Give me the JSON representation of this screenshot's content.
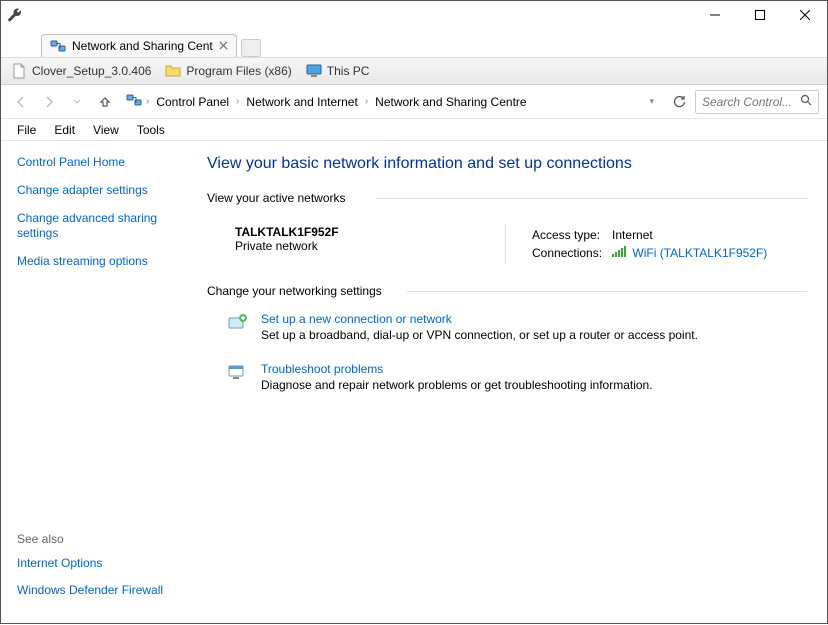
{
  "window": {
    "tab_title": "Network and Sharing Cent"
  },
  "bookmarks": [
    {
      "label": "Clover_Setup_3.0.406",
      "icon": "file-icon"
    },
    {
      "label": "Program Files (x86)",
      "icon": "folder-icon"
    },
    {
      "label": "This PC",
      "icon": "monitor-icon"
    }
  ],
  "breadcrumb": {
    "items": [
      "Control Panel",
      "Network and Internet",
      "Network and Sharing Centre"
    ]
  },
  "search": {
    "placeholder": "Search Control..."
  },
  "menubar": [
    "File",
    "Edit",
    "View",
    "Tools"
  ],
  "sidebar": {
    "home": "Control Panel Home",
    "links": [
      "Change adapter settings",
      "Change advanced sharing settings",
      "Media streaming options"
    ],
    "seealso_label": "See also",
    "seealso": [
      "Internet Options",
      "Windows Defender Firewall"
    ]
  },
  "main": {
    "heading": "View your basic network information and set up connections",
    "active_label": "View your active networks",
    "network": {
      "name": "TALKTALK1F952F",
      "type": "Private network",
      "access_label": "Access type:",
      "access_value": "Internet",
      "conn_label": "Connections:",
      "conn_value": "WiFi (TALKTALK1F952F)"
    },
    "change_label": "Change your networking settings",
    "tasks": [
      {
        "title": "Set up a new connection or network",
        "desc": "Set up a broadband, dial-up or VPN connection, or set up a router or access point."
      },
      {
        "title": "Troubleshoot problems",
        "desc": "Diagnose and repair network problems or get troubleshooting information."
      }
    ]
  }
}
